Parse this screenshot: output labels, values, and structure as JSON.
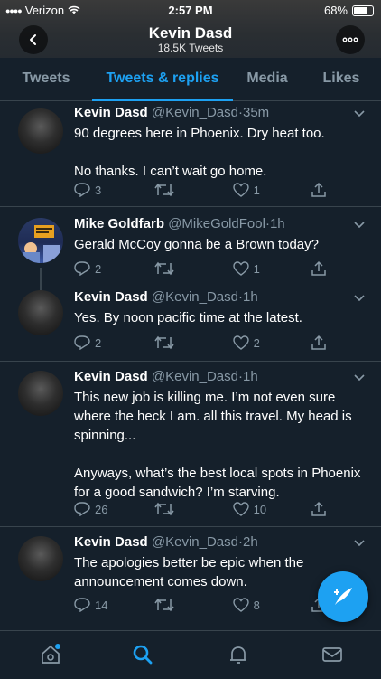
{
  "status_bar": {
    "carrier": "Verizon",
    "time": "2:57 PM",
    "battery": "68%"
  },
  "header": {
    "title": "Kevin Dasd",
    "subtitle": "18.5K Tweets"
  },
  "tabs": [
    {
      "label": "Tweets",
      "active": false
    },
    {
      "label": "Tweets & replies",
      "active": true
    },
    {
      "label": "Media",
      "active": false
    },
    {
      "label": "Likes",
      "active": false
    }
  ],
  "tweets": [
    {
      "name": "Kevin Dasd",
      "handle": "@Kevin_Dasd",
      "dot": "·",
      "age": "35m",
      "text": "90 degrees here in Phoenix. Dry heat too.\n\nNo thanks. I can’t wait go home.",
      "replies": "3",
      "retweets": "",
      "likes": "1"
    },
    {
      "name": "Mike Goldfarb",
      "handle": "@MikeGoldFool",
      "dot": "·",
      "age": "1h",
      "text": "Gerald McCoy gonna be a Brown today?",
      "replies": "2",
      "retweets": "",
      "likes": "1"
    },
    {
      "name": "Kevin Dasd",
      "handle": "@Kevin_Dasd",
      "dot": "·",
      "age": "1h",
      "text": "Yes. By noon pacific time at the latest.",
      "replies": "2",
      "retweets": "",
      "likes": "2"
    },
    {
      "name": "Kevin Dasd",
      "handle": "@Kevin_Dasd",
      "dot": "·",
      "age": "1h",
      "text": "This new job is killing me. I’m not even sure where the heck I am. all this travel. My head is spinning...\n\nAnyways, what’s the best local spots in Phoenix for a good sandwich? I’m starving.",
      "replies": "26",
      "retweets": "",
      "likes": "10"
    },
    {
      "name": "Kevin Dasd",
      "handle": "@Kevin_Dasd",
      "dot": "·",
      "age": "2h",
      "text": "The apologies better be epic when the announcement comes down.",
      "replies": "14",
      "retweets": "",
      "likes": "8"
    }
  ],
  "colors": {
    "background": "#15202b",
    "accent": "#1da1f2",
    "muted": "#8899a6",
    "divider": "#38444d"
  },
  "icons": {
    "back": "back-arrow-icon",
    "more": "more-icon",
    "reply": "reply-icon",
    "retweet": "retweet-icon",
    "like": "heart-icon",
    "share": "share-icon",
    "compose": "compose-icon",
    "home": "home-icon",
    "search": "search-icon",
    "notifications": "bell-icon",
    "messages": "mail-icon"
  }
}
